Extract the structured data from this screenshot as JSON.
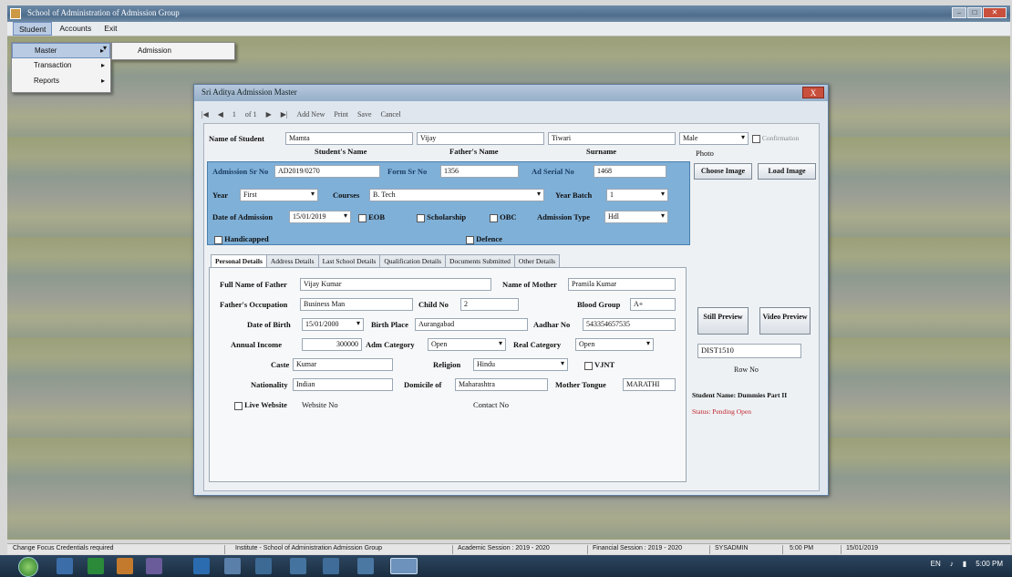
{
  "window": {
    "title": "School of Administration of Admission Group"
  },
  "menubar": {
    "items": [
      "Student",
      "Accounts",
      "Exit"
    ]
  },
  "dropdown": {
    "items": [
      "Master",
      "Transaction",
      "Reports"
    ],
    "submenu": "Admission"
  },
  "form": {
    "title": "Sri Aditya Admission Master",
    "close": "X",
    "toolbar": [
      "|◀",
      "◀",
      "1",
      "of 1",
      "▶",
      "▶|",
      "Add New",
      "Print",
      "Save",
      "Cancel"
    ],
    "name_label": "Name of Student",
    "first_name": "Mamta",
    "middle_name": "Vijay",
    "last_name": "Tiwari",
    "gender": "Male",
    "name_captions": [
      "Student's Name",
      "Father's Name",
      "Surname"
    ],
    "right_checkbox": "Confirmation",
    "blue_panel": {
      "gr_label": "Admission Sr No",
      "gr_value": "AD2019/0270",
      "roll_label": "Form Sr No",
      "roll_value": "1356",
      "admit_label": "Ad Serial No",
      "admit_value": "1468",
      "year_label": "Year",
      "year_value": "First",
      "stream_label": "Courses",
      "stream_value": "B. Tech",
      "year_batch_label": "Year Batch",
      "year_batch_value": "1",
      "date_label": "Date of Admission",
      "date_value": "15/01/2019",
      "checks": [
        "EOB",
        "Scholarship",
        "OBC"
      ],
      "adm_type_label": "Admission Type",
      "adm_type_value": "Hdl",
      "handicapped": "Handicapped",
      "defence": "Defence"
    },
    "photo": {
      "label": "Photo",
      "choose": "Choose Image",
      "load": "Load Image"
    },
    "tabs": [
      "Personal Details",
      "Address Details",
      "Last School Details",
      "Qualification Details",
      "Documents Submitted",
      "Other Details"
    ],
    "personal": {
      "father_full_label": "Full Name of Father",
      "father_full_value": "Vijay Kumar",
      "mother_label": "Name of Mother",
      "mother_value": "Pramila Kumar",
      "occupation_label": "Father's Occupation",
      "occupation_value": "Business Man",
      "child_label": "Child No",
      "child_value": "2",
      "blood_label": "Blood Group",
      "blood_value": "A+",
      "dob_label": "Date of Birth",
      "dob_value": "15/01/2000",
      "birthplace_label": "Birth Place",
      "birthplace_value": "Aurangabad",
      "aadhar_label": "Aadhar No",
      "aadhar_value": "543354657535",
      "income_label": "Annual Income",
      "income_value": "300000",
      "adm_cat_label": "Adm Category",
      "adm_cat_value": "Open",
      "real_cat_label": "Real Category",
      "real_cat_value": "Open",
      "caste_label": "Caste",
      "caste_value": "Kumar",
      "religion_label": "Religion",
      "religion_value": "Hindu",
      "vjnt_label": "VJNT",
      "nationality_label": "Nationality",
      "nationality_value": "Indian",
      "domicile_label": "Domicile of",
      "domicile_value": "Maharashtra",
      "mother_tongue_label": "Mother Tongue",
      "mother_tongue_value": "MARATHI",
      "live_label": "Live Website",
      "website_label": "Website No",
      "contact_label": "Contact No"
    },
    "side": {
      "still_preview": "Still Preview",
      "video_preview": "Video Preview",
      "code": "DIST1510",
      "row_no": "Row No",
      "student_name_label": "Student Name: Dummies Part II",
      "status_red": "Status: Pending Open"
    }
  },
  "statusbar": {
    "left": "Change Focus Credentials required",
    "institute": "Institute - School of Administration Admission Group",
    "academic": "Academic Session : 2019 - 2020",
    "financial": "Financial Session : 2019 - 2020",
    "user": "SYSADMIN",
    "time": "5:00 PM",
    "date": "15/01/2019"
  },
  "taskbar": {
    "time": "5:00 PM",
    "tray": "EN"
  }
}
